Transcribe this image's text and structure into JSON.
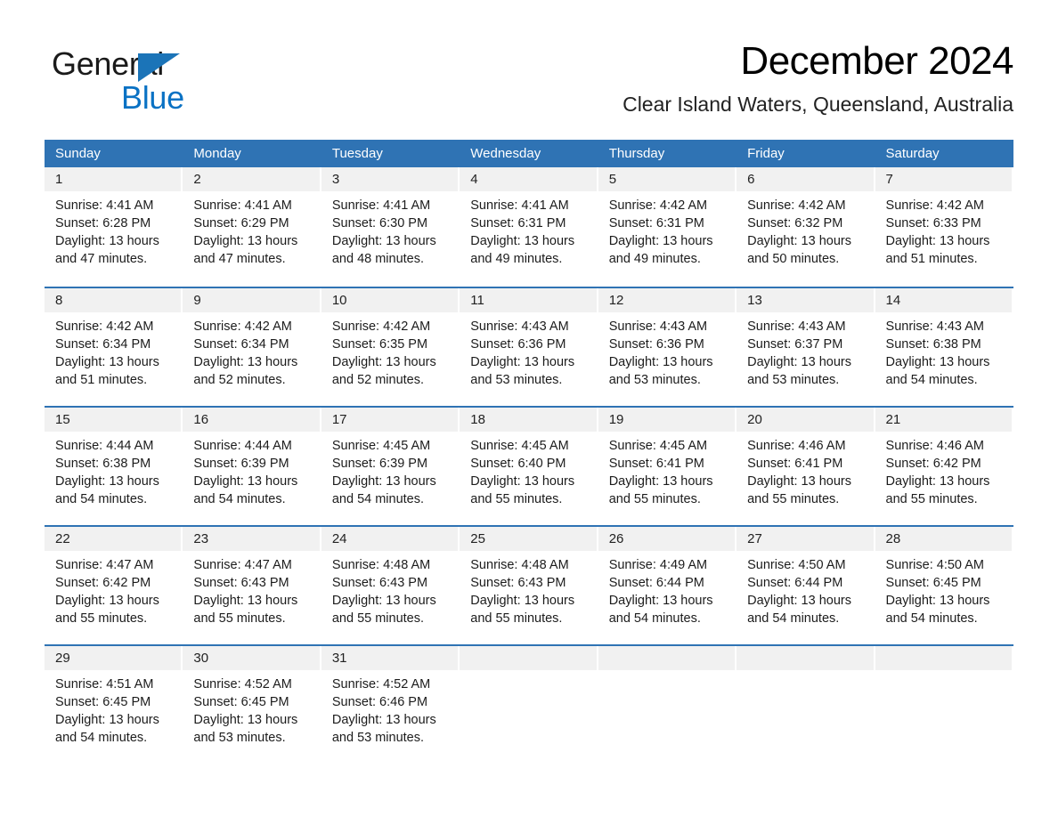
{
  "brand": {
    "name_part1": "General",
    "name_part2": "Blue",
    "triangle_color": "#1b74b8",
    "blue_color": "#0a72c4"
  },
  "header": {
    "month_title": "December 2024",
    "location": "Clear Island Waters, Queensland, Australia"
  },
  "theme": {
    "header_blue": "#2f73b4",
    "row_divider_blue": "#2f73b4",
    "day_band_gray": "#f1f1f1",
    "text_color": "#1c1c1c"
  },
  "calendar": {
    "weekdays": [
      "Sunday",
      "Monday",
      "Tuesday",
      "Wednesday",
      "Thursday",
      "Friday",
      "Saturday"
    ],
    "weeks": [
      [
        {
          "day": "1",
          "sunrise": "Sunrise: 4:41 AM",
          "sunset": "Sunset: 6:28 PM",
          "daylight_line1": "Daylight: 13 hours",
          "daylight_line2": "and 47 minutes."
        },
        {
          "day": "2",
          "sunrise": "Sunrise: 4:41 AM",
          "sunset": "Sunset: 6:29 PM",
          "daylight_line1": "Daylight: 13 hours",
          "daylight_line2": "and 47 minutes."
        },
        {
          "day": "3",
          "sunrise": "Sunrise: 4:41 AM",
          "sunset": "Sunset: 6:30 PM",
          "daylight_line1": "Daylight: 13 hours",
          "daylight_line2": "and 48 minutes."
        },
        {
          "day": "4",
          "sunrise": "Sunrise: 4:41 AM",
          "sunset": "Sunset: 6:31 PM",
          "daylight_line1": "Daylight: 13 hours",
          "daylight_line2": "and 49 minutes."
        },
        {
          "day": "5",
          "sunrise": "Sunrise: 4:42 AM",
          "sunset": "Sunset: 6:31 PM",
          "daylight_line1": "Daylight: 13 hours",
          "daylight_line2": "and 49 minutes."
        },
        {
          "day": "6",
          "sunrise": "Sunrise: 4:42 AM",
          "sunset": "Sunset: 6:32 PM",
          "daylight_line1": "Daylight: 13 hours",
          "daylight_line2": "and 50 minutes."
        },
        {
          "day": "7",
          "sunrise": "Sunrise: 4:42 AM",
          "sunset": "Sunset: 6:33 PM",
          "daylight_line1": "Daylight: 13 hours",
          "daylight_line2": "and 51 minutes."
        }
      ],
      [
        {
          "day": "8",
          "sunrise": "Sunrise: 4:42 AM",
          "sunset": "Sunset: 6:34 PM",
          "daylight_line1": "Daylight: 13 hours",
          "daylight_line2": "and 51 minutes."
        },
        {
          "day": "9",
          "sunrise": "Sunrise: 4:42 AM",
          "sunset": "Sunset: 6:34 PM",
          "daylight_line1": "Daylight: 13 hours",
          "daylight_line2": "and 52 minutes."
        },
        {
          "day": "10",
          "sunrise": "Sunrise: 4:42 AM",
          "sunset": "Sunset: 6:35 PM",
          "daylight_line1": "Daylight: 13 hours",
          "daylight_line2": "and 52 minutes."
        },
        {
          "day": "11",
          "sunrise": "Sunrise: 4:43 AM",
          "sunset": "Sunset: 6:36 PM",
          "daylight_line1": "Daylight: 13 hours",
          "daylight_line2": "and 53 minutes."
        },
        {
          "day": "12",
          "sunrise": "Sunrise: 4:43 AM",
          "sunset": "Sunset: 6:36 PM",
          "daylight_line1": "Daylight: 13 hours",
          "daylight_line2": "and 53 minutes."
        },
        {
          "day": "13",
          "sunrise": "Sunrise: 4:43 AM",
          "sunset": "Sunset: 6:37 PM",
          "daylight_line1": "Daylight: 13 hours",
          "daylight_line2": "and 53 minutes."
        },
        {
          "day": "14",
          "sunrise": "Sunrise: 4:43 AM",
          "sunset": "Sunset: 6:38 PM",
          "daylight_line1": "Daylight: 13 hours",
          "daylight_line2": "and 54 minutes."
        }
      ],
      [
        {
          "day": "15",
          "sunrise": "Sunrise: 4:44 AM",
          "sunset": "Sunset: 6:38 PM",
          "daylight_line1": "Daylight: 13 hours",
          "daylight_line2": "and 54 minutes."
        },
        {
          "day": "16",
          "sunrise": "Sunrise: 4:44 AM",
          "sunset": "Sunset: 6:39 PM",
          "daylight_line1": "Daylight: 13 hours",
          "daylight_line2": "and 54 minutes."
        },
        {
          "day": "17",
          "sunrise": "Sunrise: 4:45 AM",
          "sunset": "Sunset: 6:39 PM",
          "daylight_line1": "Daylight: 13 hours",
          "daylight_line2": "and 54 minutes."
        },
        {
          "day": "18",
          "sunrise": "Sunrise: 4:45 AM",
          "sunset": "Sunset: 6:40 PM",
          "daylight_line1": "Daylight: 13 hours",
          "daylight_line2": "and 55 minutes."
        },
        {
          "day": "19",
          "sunrise": "Sunrise: 4:45 AM",
          "sunset": "Sunset: 6:41 PM",
          "daylight_line1": "Daylight: 13 hours",
          "daylight_line2": "and 55 minutes."
        },
        {
          "day": "20",
          "sunrise": "Sunrise: 4:46 AM",
          "sunset": "Sunset: 6:41 PM",
          "daylight_line1": "Daylight: 13 hours",
          "daylight_line2": "and 55 minutes."
        },
        {
          "day": "21",
          "sunrise": "Sunrise: 4:46 AM",
          "sunset": "Sunset: 6:42 PM",
          "daylight_line1": "Daylight: 13 hours",
          "daylight_line2": "and 55 minutes."
        }
      ],
      [
        {
          "day": "22",
          "sunrise": "Sunrise: 4:47 AM",
          "sunset": "Sunset: 6:42 PM",
          "daylight_line1": "Daylight: 13 hours",
          "daylight_line2": "and 55 minutes."
        },
        {
          "day": "23",
          "sunrise": "Sunrise: 4:47 AM",
          "sunset": "Sunset: 6:43 PM",
          "daylight_line1": "Daylight: 13 hours",
          "daylight_line2": "and 55 minutes."
        },
        {
          "day": "24",
          "sunrise": "Sunrise: 4:48 AM",
          "sunset": "Sunset: 6:43 PM",
          "daylight_line1": "Daylight: 13 hours",
          "daylight_line2": "and 55 minutes."
        },
        {
          "day": "25",
          "sunrise": "Sunrise: 4:48 AM",
          "sunset": "Sunset: 6:43 PM",
          "daylight_line1": "Daylight: 13 hours",
          "daylight_line2": "and 55 minutes."
        },
        {
          "day": "26",
          "sunrise": "Sunrise: 4:49 AM",
          "sunset": "Sunset: 6:44 PM",
          "daylight_line1": "Daylight: 13 hours",
          "daylight_line2": "and 54 minutes."
        },
        {
          "day": "27",
          "sunrise": "Sunrise: 4:50 AM",
          "sunset": "Sunset: 6:44 PM",
          "daylight_line1": "Daylight: 13 hours",
          "daylight_line2": "and 54 minutes."
        },
        {
          "day": "28",
          "sunrise": "Sunrise: 4:50 AM",
          "sunset": "Sunset: 6:45 PM",
          "daylight_line1": "Daylight: 13 hours",
          "daylight_line2": "and 54 minutes."
        }
      ],
      [
        {
          "day": "29",
          "sunrise": "Sunrise: 4:51 AM",
          "sunset": "Sunset: 6:45 PM",
          "daylight_line1": "Daylight: 13 hours",
          "daylight_line2": "and 54 minutes."
        },
        {
          "day": "30",
          "sunrise": "Sunrise: 4:52 AM",
          "sunset": "Sunset: 6:45 PM",
          "daylight_line1": "Daylight: 13 hours",
          "daylight_line2": "and 53 minutes."
        },
        {
          "day": "31",
          "sunrise": "Sunrise: 4:52 AM",
          "sunset": "Sunset: 6:46 PM",
          "daylight_line1": "Daylight: 13 hours",
          "daylight_line2": "and 53 minutes."
        },
        {
          "day": "",
          "sunrise": "",
          "sunset": "",
          "daylight_line1": "",
          "daylight_line2": ""
        },
        {
          "day": "",
          "sunrise": "",
          "sunset": "",
          "daylight_line1": "",
          "daylight_line2": ""
        },
        {
          "day": "",
          "sunrise": "",
          "sunset": "",
          "daylight_line1": "",
          "daylight_line2": ""
        },
        {
          "day": "",
          "sunrise": "",
          "sunset": "",
          "daylight_line1": "",
          "daylight_line2": ""
        }
      ]
    ]
  }
}
